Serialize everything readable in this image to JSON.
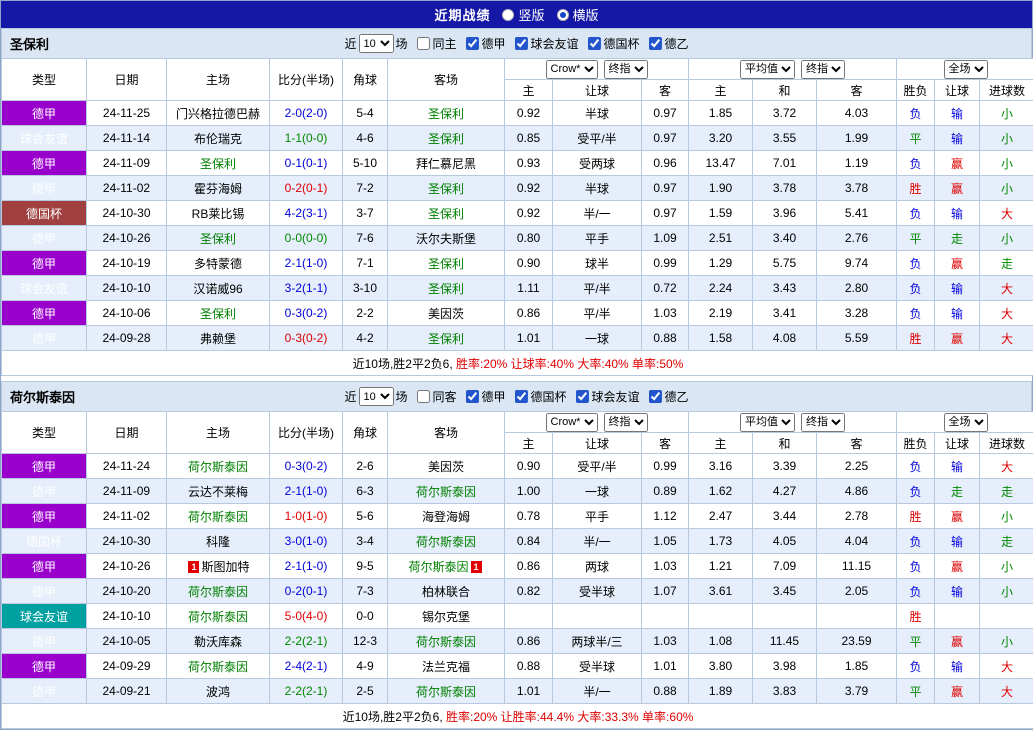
{
  "colors": {
    "topbar_bg": "#1518a6",
    "section_head_bg": "#dae6f3",
    "row_alt_bg": "#e5eefa",
    "table_border": "#b7c9de",
    "league_bundesliga": "#9900cc",
    "league_friendly": "#00a0a0",
    "league_cup": "#a04040",
    "featured_team_green": "#008000",
    "win_red": "#e00000",
    "draw_green": "#008800",
    "loss_blue": "#0000dd"
  },
  "topbar": {
    "title": "近期战绩",
    "radio_vertical": "竖版",
    "radio_horizontal": "横版",
    "selected": "横版"
  },
  "controls": {
    "near": "近",
    "count": "10",
    "matches": "场",
    "crow": "Crow*",
    "final_odds": "终指",
    "average": "平均值",
    "full_match": "全场"
  },
  "columns": {
    "type": "类型",
    "date": "日期",
    "home": "主场",
    "score": "比分(半场)",
    "corners": "角球",
    "away": "客场",
    "h": "主",
    "handicap": "让球",
    "a": "客",
    "avg_h": "主",
    "avg_d": "和",
    "avg_a": "客",
    "wdl": "胜负",
    "hcp_res": "让球",
    "goals_res": "进球数"
  },
  "sections": [
    {
      "team": "圣保利",
      "same_venue_label": "同主",
      "same_venue_checked": false,
      "leagues": [
        {
          "label": "德甲",
          "checked": true
        },
        {
          "label": "球会友谊",
          "checked": true
        },
        {
          "label": "德国杯",
          "checked": true
        },
        {
          "label": "德乙",
          "checked": true
        }
      ],
      "rows": [
        {
          "league": "德甲",
          "lgk": "bundesliga",
          "date": "24-11-25",
          "home": "门兴格拉德巴赫",
          "home_feat": false,
          "home_card": "",
          "score": "2-0(2-0)",
          "score_c": "blue",
          "corners": "5-4",
          "away": "圣保利",
          "away_feat": true,
          "away_card": "",
          "odds": [
            "0.92",
            "半球",
            "0.97"
          ],
          "avg": [
            "1.85",
            "3.72",
            "4.03"
          ],
          "res": [
            [
              "负",
              "blue"
            ],
            [
              "输",
              "blue"
            ],
            [
              "小",
              "green"
            ]
          ]
        },
        {
          "league": "球会友谊",
          "lgk": "friendly",
          "date": "24-11-14",
          "home": "布伦瑞克",
          "home_feat": false,
          "home_card": "",
          "score": "1-1(0-0)",
          "score_c": "green",
          "corners": "4-6",
          "away": "圣保利",
          "away_feat": true,
          "away_card": "",
          "odds": [
            "0.85",
            "受平/半",
            "0.97"
          ],
          "avg": [
            "3.20",
            "3.55",
            "1.99"
          ],
          "res": [
            [
              "平",
              "green"
            ],
            [
              "输",
              "blue"
            ],
            [
              "小",
              "green"
            ]
          ]
        },
        {
          "league": "德甲",
          "lgk": "bundesliga",
          "date": "24-11-09",
          "home": "圣保利",
          "home_feat": true,
          "home_card": "",
          "score": "0-1(0-1)",
          "score_c": "blue",
          "corners": "5-10",
          "away": "拜仁慕尼黑",
          "away_feat": false,
          "away_card": "",
          "odds": [
            "0.93",
            "受两球",
            "0.96"
          ],
          "avg": [
            "13.47",
            "7.01",
            "1.19"
          ],
          "res": [
            [
              "负",
              "blue"
            ],
            [
              "赢",
              "red"
            ],
            [
              "小",
              "green"
            ]
          ]
        },
        {
          "league": "德甲",
          "lgk": "bundesliga",
          "date": "24-11-02",
          "home": "霍芬海姆",
          "home_feat": false,
          "home_card": "",
          "score": "0-2(0-1)",
          "score_c": "red",
          "corners": "7-2",
          "away": "圣保利",
          "away_feat": true,
          "away_card": "",
          "odds": [
            "0.92",
            "半球",
            "0.97"
          ],
          "avg": [
            "1.90",
            "3.78",
            "3.78"
          ],
          "res": [
            [
              "胜",
              "red"
            ],
            [
              "赢",
              "red"
            ],
            [
              "小",
              "green"
            ]
          ]
        },
        {
          "league": "德国杯",
          "lgk": "cup",
          "date": "24-10-30",
          "home": "RB莱比锡",
          "home_feat": false,
          "home_card": "",
          "score": "4-2(3-1)",
          "score_c": "blue",
          "corners": "3-7",
          "away": "圣保利",
          "away_feat": true,
          "away_card": "",
          "odds": [
            "0.92",
            "半/一",
            "0.97"
          ],
          "avg": [
            "1.59",
            "3.96",
            "5.41"
          ],
          "res": [
            [
              "负",
              "blue"
            ],
            [
              "输",
              "blue"
            ],
            [
              "大",
              "red"
            ]
          ]
        },
        {
          "league": "德甲",
          "lgk": "bundesliga",
          "date": "24-10-26",
          "home": "圣保利",
          "home_feat": true,
          "home_card": "",
          "score": "0-0(0-0)",
          "score_c": "green",
          "corners": "7-6",
          "away": "沃尔夫斯堡",
          "away_feat": false,
          "away_card": "",
          "odds": [
            "0.80",
            "平手",
            "1.09"
          ],
          "avg": [
            "2.51",
            "3.40",
            "2.76"
          ],
          "res": [
            [
              "平",
              "green"
            ],
            [
              "走",
              "green"
            ],
            [
              "小",
              "green"
            ]
          ]
        },
        {
          "league": "德甲",
          "lgk": "bundesliga",
          "date": "24-10-19",
          "home": "多特蒙德",
          "home_feat": false,
          "home_card": "",
          "score": "2-1(1-0)",
          "score_c": "blue",
          "corners": "7-1",
          "away": "圣保利",
          "away_feat": true,
          "away_card": "",
          "odds": [
            "0.90",
            "球半",
            "0.99"
          ],
          "avg": [
            "1.29",
            "5.75",
            "9.74"
          ],
          "res": [
            [
              "负",
              "blue"
            ],
            [
              "赢",
              "red"
            ],
            [
              "走",
              "green"
            ]
          ]
        },
        {
          "league": "球会友谊",
          "lgk": "friendly",
          "date": "24-10-10",
          "home": "汉诺威96",
          "home_feat": false,
          "home_card": "",
          "score": "3-2(1-1)",
          "score_c": "blue",
          "corners": "3-10",
          "away": "圣保利",
          "away_feat": true,
          "away_card": "",
          "odds": [
            "1.11",
            "平/半",
            "0.72"
          ],
          "avg": [
            "2.24",
            "3.43",
            "2.80"
          ],
          "res": [
            [
              "负",
              "blue"
            ],
            [
              "输",
              "blue"
            ],
            [
              "大",
              "red"
            ]
          ]
        },
        {
          "league": "德甲",
          "lgk": "bundesliga",
          "date": "24-10-06",
          "home": "圣保利",
          "home_feat": true,
          "home_card": "",
          "score": "0-3(0-2)",
          "score_c": "blue",
          "corners": "2-2",
          "away": "美因茨",
          "away_feat": false,
          "away_card": "",
          "odds": [
            "0.86",
            "平/半",
            "1.03"
          ],
          "avg": [
            "2.19",
            "3.41",
            "3.28"
          ],
          "res": [
            [
              "负",
              "blue"
            ],
            [
              "输",
              "blue"
            ],
            [
              "大",
              "red"
            ]
          ]
        },
        {
          "league": "德甲",
          "lgk": "bundesliga",
          "date": "24-09-28",
          "home": "弗赖堡",
          "home_feat": false,
          "home_card": "",
          "score": "0-3(0-2)",
          "score_c": "red",
          "corners": "4-2",
          "away": "圣保利",
          "away_feat": true,
          "away_card": "",
          "odds": [
            "1.01",
            "一球",
            "0.88"
          ],
          "avg": [
            "1.58",
            "4.08",
            "5.59"
          ],
          "res": [
            [
              "胜",
              "red"
            ],
            [
              "赢",
              "red"
            ],
            [
              "大",
              "red"
            ]
          ]
        }
      ],
      "summary_black": "近10场,胜2平2负6,",
      "summary_red": "胜率:20% 让球率:40% 大率:40% 单率:50%"
    },
    {
      "team": "荷尔斯泰因",
      "same_venue_label": "同客",
      "same_venue_checked": false,
      "leagues": [
        {
          "label": "德甲",
          "checked": true
        },
        {
          "label": "德国杯",
          "checked": true
        },
        {
          "label": "球会友谊",
          "checked": true
        },
        {
          "label": "德乙",
          "checked": true
        }
      ],
      "rows": [
        {
          "league": "德甲",
          "lgk": "bundesliga",
          "date": "24-11-24",
          "home": "荷尔斯泰因",
          "home_feat": true,
          "home_card": "",
          "score": "0-3(0-2)",
          "score_c": "blue",
          "corners": "2-6",
          "away": "美因茨",
          "away_feat": false,
          "away_card": "",
          "odds": [
            "0.90",
            "受平/半",
            "0.99"
          ],
          "avg": [
            "3.16",
            "3.39",
            "2.25"
          ],
          "res": [
            [
              "负",
              "blue"
            ],
            [
              "输",
              "blue"
            ],
            [
              "大",
              "red"
            ]
          ]
        },
        {
          "league": "德甲",
          "lgk": "bundesliga",
          "date": "24-11-09",
          "home": "云达不莱梅",
          "home_feat": false,
          "home_card": "",
          "score": "2-1(1-0)",
          "score_c": "blue",
          "corners": "6-3",
          "away": "荷尔斯泰因",
          "away_feat": true,
          "away_card": "",
          "odds": [
            "1.00",
            "一球",
            "0.89"
          ],
          "avg": [
            "1.62",
            "4.27",
            "4.86"
          ],
          "res": [
            [
              "负",
              "blue"
            ],
            [
              "走",
              "green"
            ],
            [
              "走",
              "green"
            ]
          ]
        },
        {
          "league": "德甲",
          "lgk": "bundesliga",
          "date": "24-11-02",
          "home": "荷尔斯泰因",
          "home_feat": true,
          "home_card": "",
          "score": "1-0(1-0)",
          "score_c": "red",
          "corners": "5-6",
          "away": "海登海姆",
          "away_feat": false,
          "away_card": "",
          "odds": [
            "0.78",
            "平手",
            "1.12"
          ],
          "avg": [
            "2.47",
            "3.44",
            "2.78"
          ],
          "res": [
            [
              "胜",
              "red"
            ],
            [
              "赢",
              "red"
            ],
            [
              "小",
              "green"
            ]
          ]
        },
        {
          "league": "德国杯",
          "lgk": "cup",
          "date": "24-10-30",
          "home": "科隆",
          "home_feat": false,
          "home_card": "",
          "score": "3-0(1-0)",
          "score_c": "blue",
          "corners": "3-4",
          "away": "荷尔斯泰因",
          "away_feat": true,
          "away_card": "",
          "odds": [
            "0.84",
            "半/一",
            "1.05"
          ],
          "avg": [
            "1.73",
            "4.05",
            "4.04"
          ],
          "res": [
            [
              "负",
              "blue"
            ],
            [
              "输",
              "blue"
            ],
            [
              "走",
              "green"
            ]
          ]
        },
        {
          "league": "德甲",
          "lgk": "bundesliga",
          "date": "24-10-26",
          "home": "斯图加特",
          "home_feat": false,
          "home_card": "1",
          "score": "2-1(1-0)",
          "score_c": "blue",
          "corners": "9-5",
          "away": "荷尔斯泰因",
          "away_feat": true,
          "away_card": "1",
          "odds": [
            "0.86",
            "两球",
            "1.03"
          ],
          "avg": [
            "1.21",
            "7.09",
            "11.15"
          ],
          "res": [
            [
              "负",
              "blue"
            ],
            [
              "赢",
              "red"
            ],
            [
              "小",
              "green"
            ]
          ]
        },
        {
          "league": "德甲",
          "lgk": "bundesliga",
          "date": "24-10-20",
          "home": "荷尔斯泰因",
          "home_feat": true,
          "home_card": "",
          "score": "0-2(0-1)",
          "score_c": "blue",
          "corners": "7-3",
          "away": "柏林联合",
          "away_feat": false,
          "away_card": "",
          "odds": [
            "0.82",
            "受半球",
            "1.07"
          ],
          "avg": [
            "3.61",
            "3.45",
            "2.05"
          ],
          "res": [
            [
              "负",
              "blue"
            ],
            [
              "输",
              "blue"
            ],
            [
              "小",
              "green"
            ]
          ]
        },
        {
          "league": "球会友谊",
          "lgk": "friendly",
          "date": "24-10-10",
          "home": "荷尔斯泰因",
          "home_feat": true,
          "home_card": "",
          "score": "5-0(4-0)",
          "score_c": "red",
          "corners": "0-0",
          "away": "锡尔克堡",
          "away_feat": false,
          "away_card": "",
          "odds": [
            "",
            "",
            ""
          ],
          "avg": [
            "",
            "",
            ""
          ],
          "res": [
            [
              "胜",
              "red"
            ],
            [
              "",
              ""
            ],
            [
              "",
              ""
            ]
          ]
        },
        {
          "league": "德甲",
          "lgk": "bundesliga",
          "date": "24-10-05",
          "home": "勒沃库森",
          "home_feat": false,
          "home_card": "",
          "score": "2-2(2-1)",
          "score_c": "green",
          "corners": "12-3",
          "away": "荷尔斯泰因",
          "away_feat": true,
          "away_card": "",
          "odds": [
            "0.86",
            "两球半/三",
            "1.03"
          ],
          "avg": [
            "1.08",
            "11.45",
            "23.59"
          ],
          "res": [
            [
              "平",
              "green"
            ],
            [
              "赢",
              "red"
            ],
            [
              "小",
              "green"
            ]
          ]
        },
        {
          "league": "德甲",
          "lgk": "bundesliga",
          "date": "24-09-29",
          "home": "荷尔斯泰因",
          "home_feat": true,
          "home_card": "",
          "score": "2-4(2-1)",
          "score_c": "blue",
          "corners": "4-9",
          "away": "法兰克福",
          "away_feat": false,
          "away_card": "",
          "odds": [
            "0.88",
            "受半球",
            "1.01"
          ],
          "avg": [
            "3.80",
            "3.98",
            "1.85"
          ],
          "res": [
            [
              "负",
              "blue"
            ],
            [
              "输",
              "blue"
            ],
            [
              "大",
              "red"
            ]
          ]
        },
        {
          "league": "德甲",
          "lgk": "bundesliga",
          "date": "24-09-21",
          "home": "波鸿",
          "home_feat": false,
          "home_card": "",
          "score": "2-2(2-1)",
          "score_c": "green",
          "corners": "2-5",
          "away": "荷尔斯泰因",
          "away_feat": true,
          "away_card": "",
          "odds": [
            "1.01",
            "半/一",
            "0.88"
          ],
          "avg": [
            "1.89",
            "3.83",
            "3.79"
          ],
          "res": [
            [
              "平",
              "green"
            ],
            [
              "赢",
              "red"
            ],
            [
              "大",
              "red"
            ]
          ]
        }
      ],
      "summary_black": "近10场,胜2平2负6,",
      "summary_red": "胜率:20% 让胜率:44.4% 大率:33.3% 单率:60%"
    }
  ]
}
